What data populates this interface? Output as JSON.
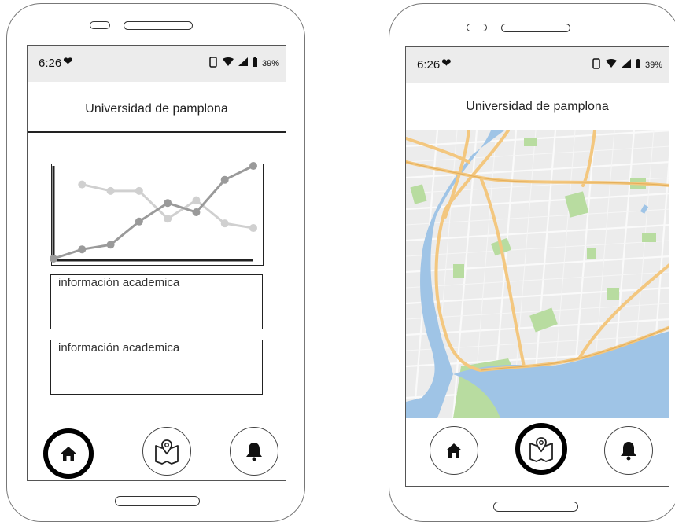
{
  "status_bar": {
    "time": "6:26",
    "battery_percent": "39%"
  },
  "app_bar": {
    "title": "Universidad de pamplona"
  },
  "home_screen": {
    "cards": [
      {
        "label": "información academica"
      },
      {
        "label": "información academica"
      }
    ]
  },
  "bottom_nav": {
    "items": [
      {
        "icon": "home-icon"
      },
      {
        "icon": "map-pin-icon"
      },
      {
        "icon": "bell-icon"
      }
    ],
    "left_phone_selected": "home",
    "right_phone_selected": "map"
  },
  "chart_data": {
    "type": "line",
    "x": [
      1,
      2,
      3,
      4,
      5,
      6,
      7,
      8,
      9
    ],
    "series": [
      {
        "values": [
          0,
          1,
          1.5,
          4,
          6,
          5,
          8.5,
          10
        ],
        "x": [
          0,
          1,
          2,
          3,
          4,
          5,
          6,
          7
        ],
        "color": "#9a9a9a"
      },
      {
        "values": [
          8,
          7.3,
          7.3,
          4.3,
          6.3,
          3.8,
          3.3
        ],
        "x": [
          1,
          2,
          3,
          4,
          5,
          6,
          7
        ],
        "color": "#d0d0d0"
      }
    ],
    "ylim": [
      0,
      10
    ],
    "xlim": [
      0,
      7
    ],
    "xlabel": "",
    "ylabel": "",
    "title": "",
    "grid": false
  },
  "colors": {
    "map_water": "#9fc4e6",
    "map_land": "#ececec",
    "map_park": "#b8dca0",
    "map_highway": "#f3c77f",
    "selected_ring": "#000000"
  }
}
